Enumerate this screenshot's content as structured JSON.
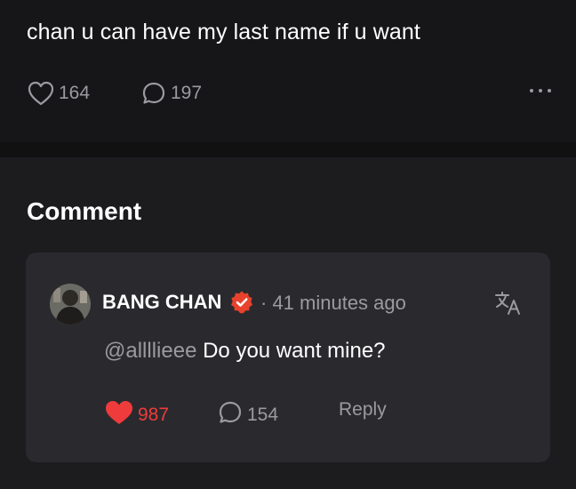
{
  "post": {
    "text": "chan u can have my last name if u want",
    "likes": "164",
    "comments": "197"
  },
  "section": {
    "title": "Comment"
  },
  "comment": {
    "author": "BANG CHAN",
    "time": "· 41 minutes ago",
    "mention": "@allllieee",
    "text": " Do you want mine?",
    "likes": "987",
    "replies": "154",
    "reply_label": "Reply"
  },
  "colors": {
    "accent_like": "#ef3b3b",
    "badge": "#e8422c",
    "muted": "#9a9aa0"
  },
  "icons": [
    "heart-icon",
    "comment-icon",
    "more-icon",
    "verified-badge-icon",
    "translate-icon"
  ]
}
